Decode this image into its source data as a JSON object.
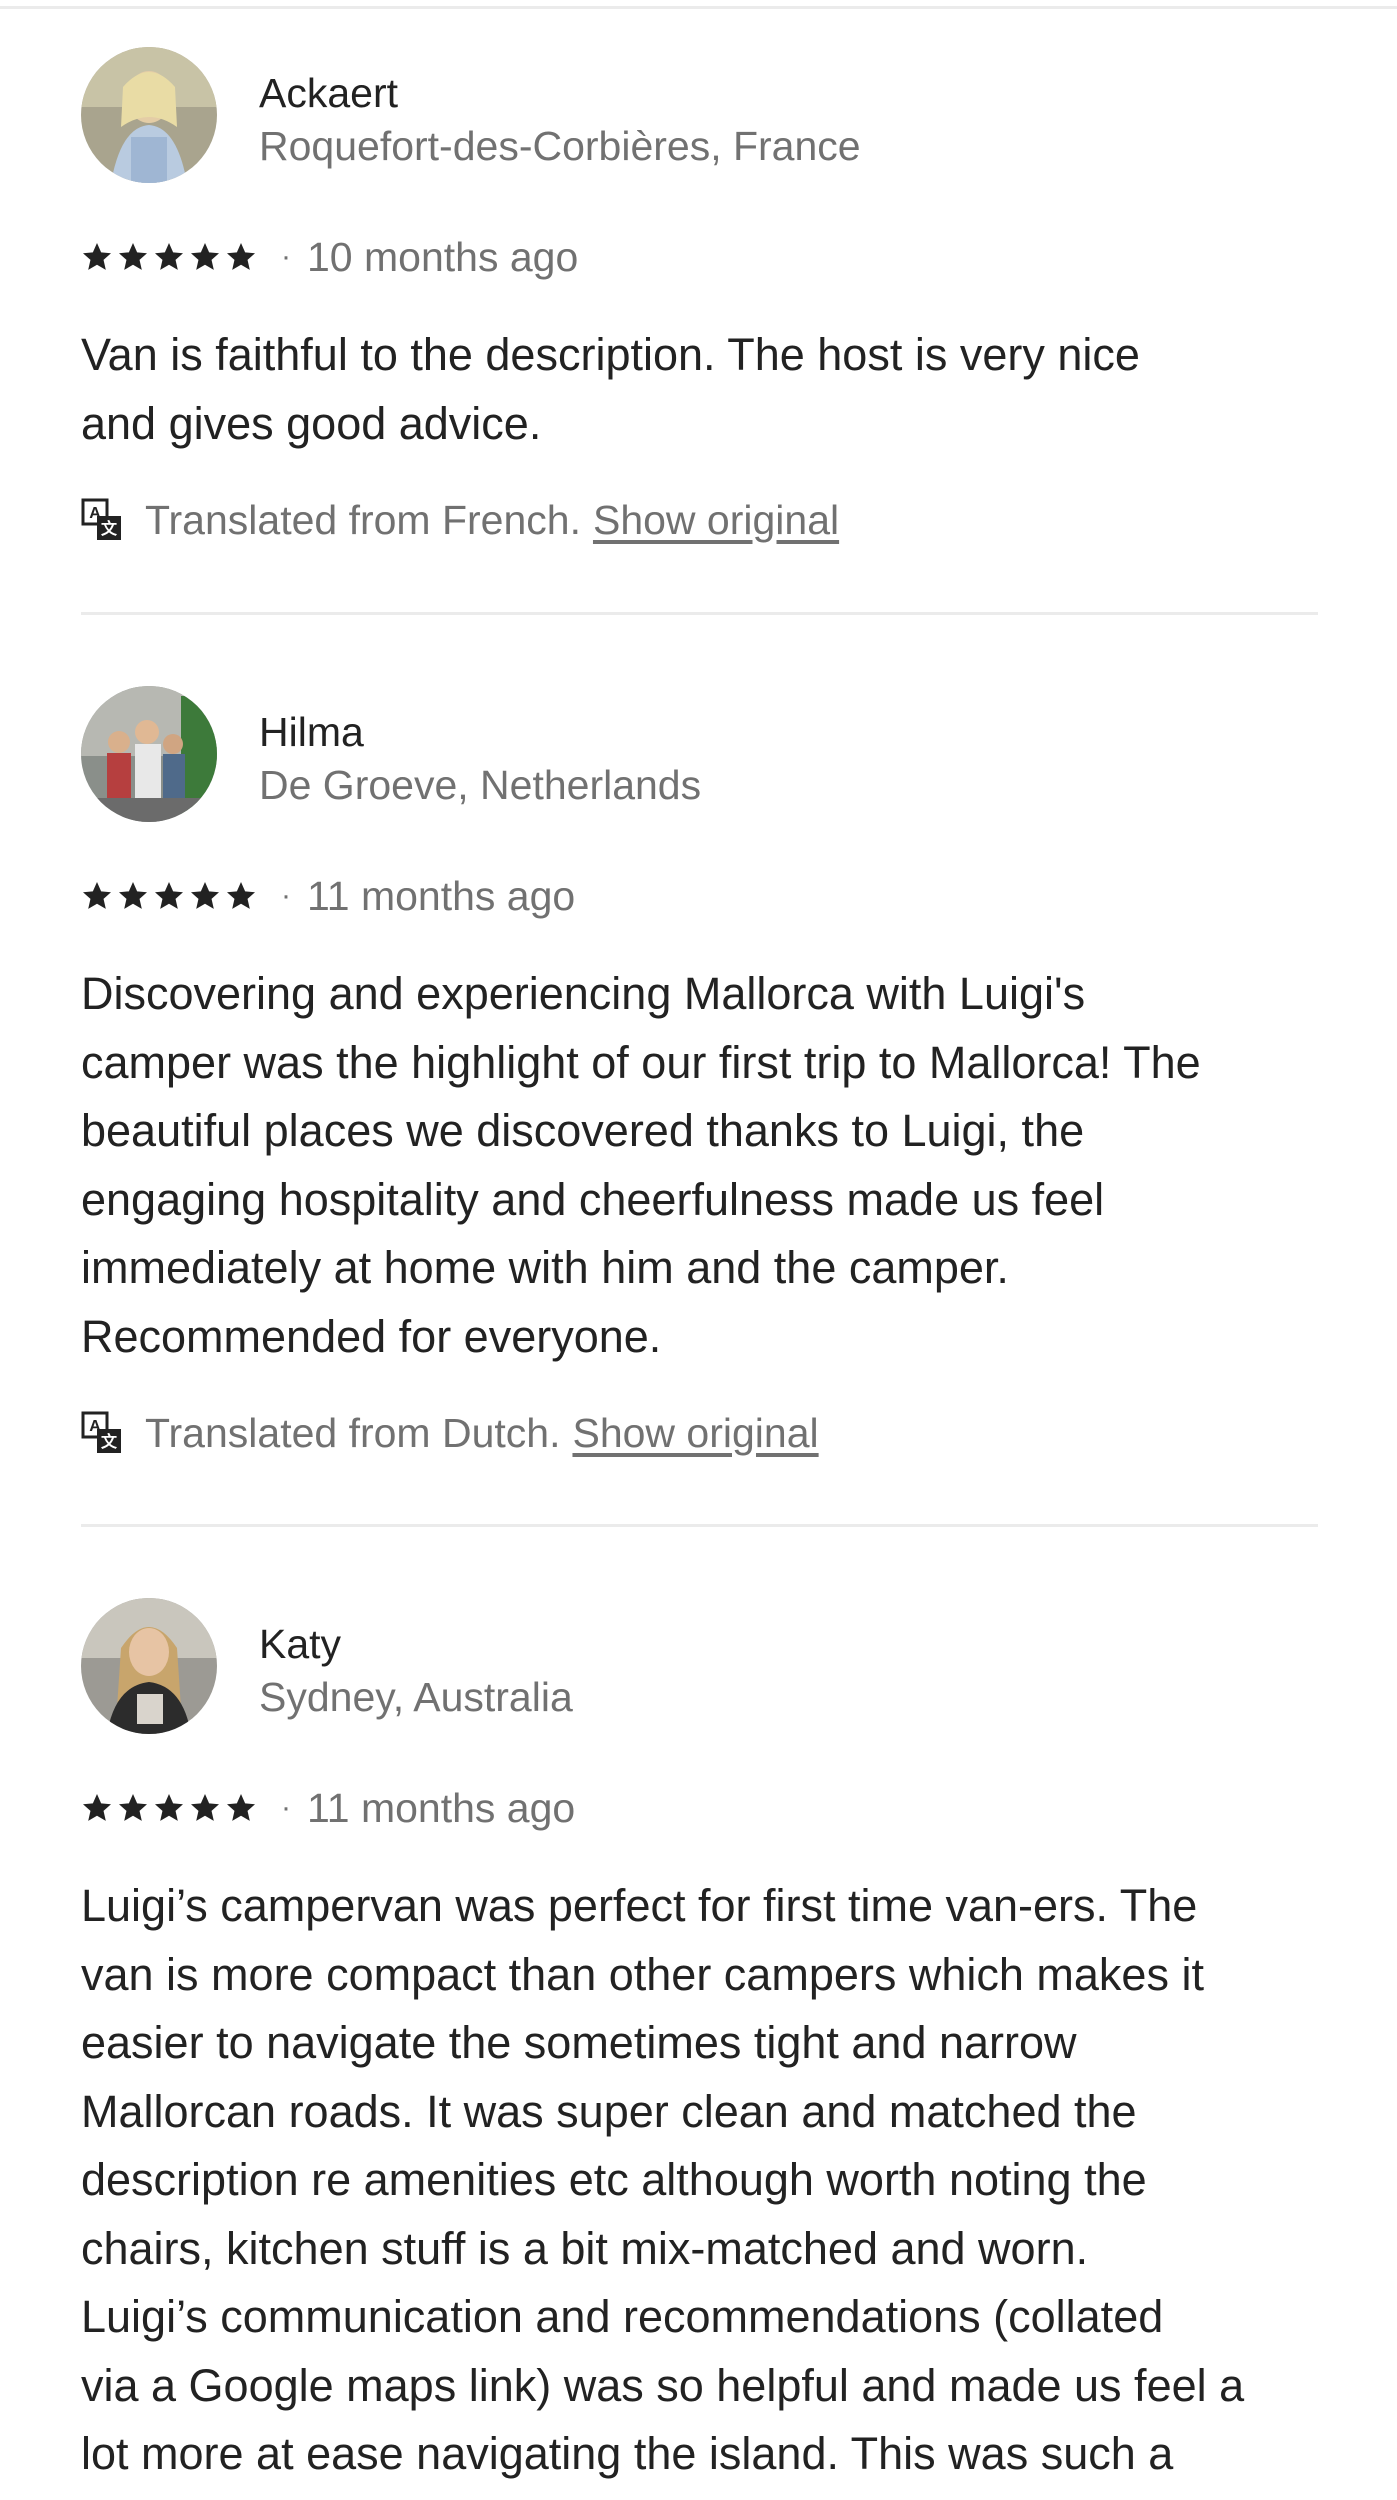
{
  "reviews": [
    {
      "name": "Ackaert",
      "location": "Roquefort-des-Corbières, France",
      "rating": 5,
      "date": "10 months ago",
      "text": "Van is faithful to the description. The host is very nice\nand gives good advice.",
      "translated_from": "Translated from French.",
      "show_original": "Show original"
    },
    {
      "name": "Hilma",
      "location": "De Groeve, Netherlands",
      "rating": 5,
      "date": "11 months ago",
      "text": "Discovering and experiencing Mallorca with Luigi's\ncamper was the highlight of our first trip to Mallorca! The\nbeautiful places we discovered thanks to Luigi, the\nengaging hospitality and cheerfulness made us feel\nimmediately at home with him and the camper.\nRecommended for everyone.",
      "translated_from": "Translated from Dutch.",
      "show_original": "Show original"
    },
    {
      "name": "Katy",
      "location": "Sydney, Australia",
      "rating": 5,
      "date": "11 months ago",
      "text": "Luigi’s campervan was perfect for first time van-ers. The\nvan is more compact than other campers which makes it\neasier to navigate the sometimes tight and narrow\nMallorcan roads. It was super clean and matched the\ndescription re amenities etc although worth noting the\nchairs, kitchen stuff is a bit mix-matched and worn.\nLuigi’s communication and recommendations (collated\nvia a Google maps link) was so helpful and made us feel a\nlot more at ease navigating the island. This was such a"
    }
  ],
  "colors": {
    "text_primary": "#222222",
    "text_secondary": "#717171",
    "divider": "#ebebeb"
  },
  "icons": {
    "star": "star-icon",
    "translate": "translate-icon"
  }
}
